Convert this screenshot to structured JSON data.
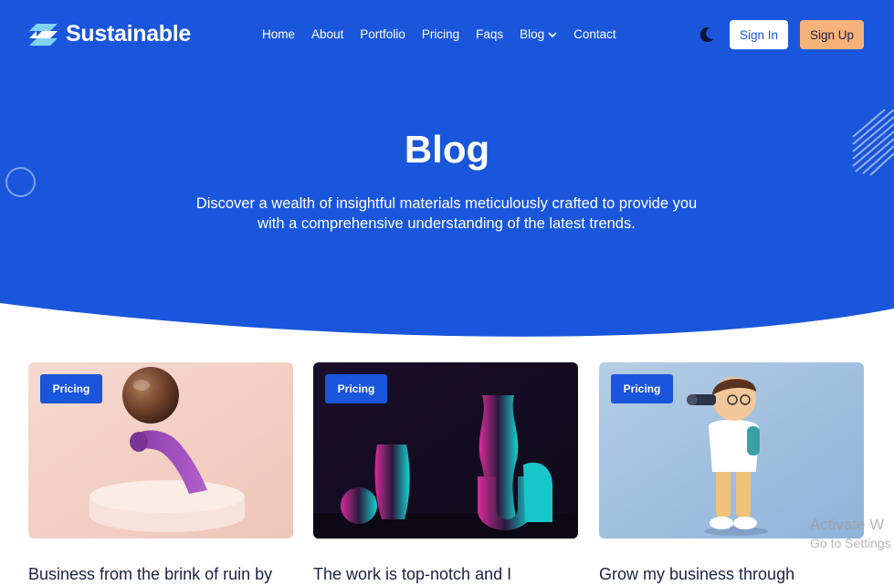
{
  "brand": {
    "name": "Sustainable"
  },
  "nav": {
    "items": [
      {
        "label": "Home"
      },
      {
        "label": "About"
      },
      {
        "label": "Portfolio"
      },
      {
        "label": "Pricing"
      },
      {
        "label": "Faqs"
      },
      {
        "label": "Blog",
        "has_dropdown": true
      },
      {
        "label": "Contact"
      }
    ]
  },
  "header": {
    "theme_toggle_icon": "moon-icon",
    "signin_label": "Sign In",
    "signup_label": "Sign Up"
  },
  "hero": {
    "title": "Blog",
    "subtitle": "Discover a wealth of insightful materials meticulously crafted to provide you with a comprehensive understanding of the latest trends."
  },
  "cards": [
    {
      "badge": "Pricing",
      "title": "Business from the brink of ruin by"
    },
    {
      "badge": "Pricing",
      "title": "The work is top-notch and I"
    },
    {
      "badge": "Pricing",
      "title": "Grow my business through"
    }
  ],
  "overlay": {
    "line1": "Activate W",
    "line2": "Go to Settings"
  },
  "colors": {
    "primary": "#1a56db",
    "accent": "#f7b27a",
    "text_dark": "#1d2144",
    "white": "#ffffff"
  }
}
